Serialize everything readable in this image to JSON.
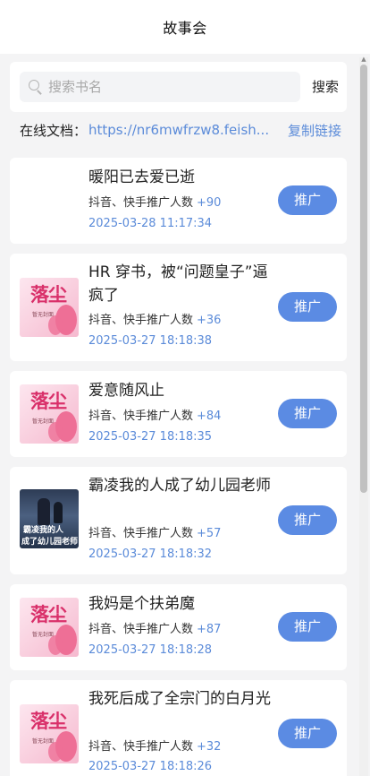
{
  "header": {
    "title": "故事会"
  },
  "search": {
    "placeholder": "搜索书名",
    "value": "",
    "button_label": "搜索"
  },
  "online_doc": {
    "label": "在线文档：",
    "link": "https://nr6mwfrzw8.feish...",
    "copy_label": "复制链接"
  },
  "books": [
    {
      "title": "暖阳已去爱已逝",
      "promo_label": "抖音、快手推广人数",
      "promo_count": "+90",
      "date": "2025-03-28 11:17:34",
      "button_label": "推广",
      "cover": "none"
    },
    {
      "title": "HR 穿书，被“问题皇子”逼疯了",
      "promo_label": "抖音、快手推广人数",
      "promo_count": "+36",
      "date": "2025-03-27 18:18:38",
      "button_label": "推广",
      "cover": "luochen",
      "cover_title": "落尘",
      "cover_sub": "暂无封面"
    },
    {
      "title": "爱意随风止",
      "promo_label": "抖音、快手推广人数",
      "promo_count": "+84",
      "date": "2025-03-27 18:18:35",
      "button_label": "推广",
      "cover": "luochen",
      "cover_title": "落尘",
      "cover_sub": "暂无封面"
    },
    {
      "title": "霸凌我的人成了幼儿园老师",
      "promo_label": "抖音、快手推广人数",
      "promo_count": "+57",
      "date": "2025-03-27 18:18:32",
      "button_label": "推广",
      "cover": "dark",
      "cover_line1": "霸凌我的人",
      "cover_line2": "成了幼儿园老师"
    },
    {
      "title": "我妈是个扶弟魔",
      "promo_label": "抖音、快手推广人数",
      "promo_count": "+87",
      "date": "2025-03-27 18:18:28",
      "button_label": "推广",
      "cover": "luochen",
      "cover_title": "落尘",
      "cover_sub": "暂无封面"
    },
    {
      "title": "我死后成了全宗门的白月光",
      "promo_label": "抖音、快手推广人数",
      "promo_count": "+32",
      "date": "2025-03-27 18:18:26",
      "button_label": "推广",
      "cover": "luochen",
      "cover_title": "落尘",
      "cover_sub": "暂无封面"
    }
  ],
  "colors": {
    "accent": "#5b8be3",
    "link": "#5b8bd9",
    "background": "#f4f4f5",
    "card": "#ffffff"
  },
  "icons": {
    "search": "search-icon"
  }
}
